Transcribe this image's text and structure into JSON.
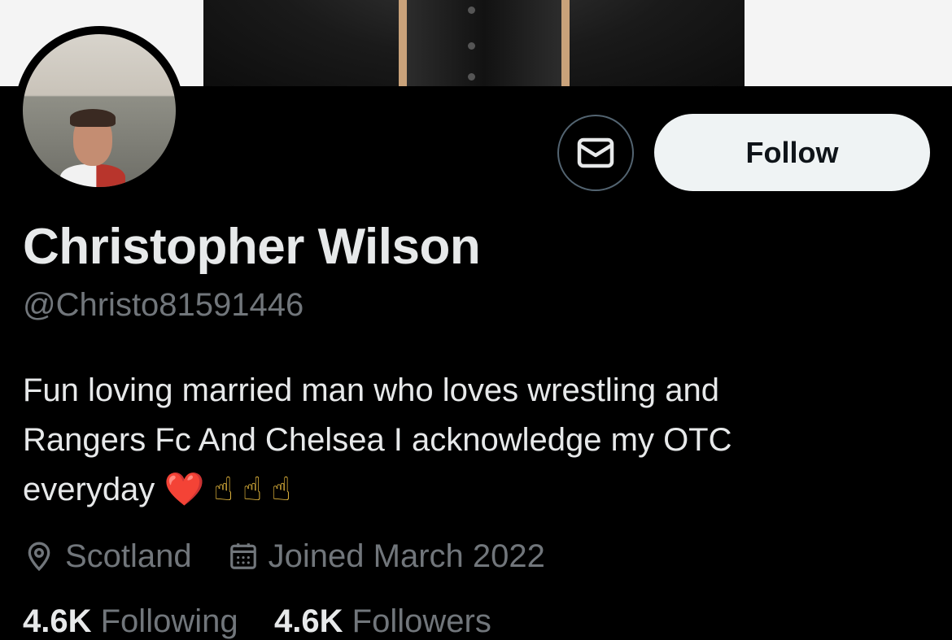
{
  "profile": {
    "display_name": "Christopher Wilson",
    "handle": "@Christo81591446",
    "bio_lines": [
      "Fun loving married man who loves wrestling and",
      "Rangers Fc And Chelsea I acknowledge my OTC",
      "everyday"
    ],
    "bio_emojis": [
      "❤️",
      "☝",
      "☝",
      "☝"
    ],
    "location": "Scotland",
    "joined": "Joined March 2022"
  },
  "actions": {
    "message_icon": "envelope-icon",
    "follow_label": "Follow"
  },
  "stats": {
    "following_count": "4.6K",
    "following_label": "Following",
    "followers_count": "4.6K",
    "followers_label": "Followers"
  },
  "colors": {
    "background": "#000000",
    "primary_text": "#e7e9ea",
    "secondary_text": "#71767b",
    "button_bg": "#eff3f4",
    "button_text": "#0f1419",
    "outline": "#536471",
    "heart": "#e0202a"
  }
}
